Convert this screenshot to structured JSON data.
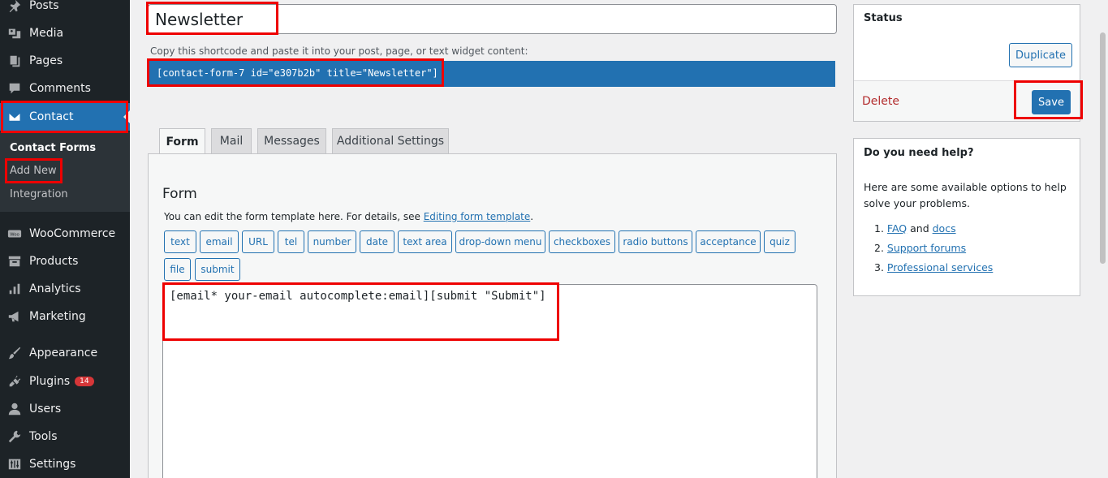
{
  "sidebar": {
    "items": [
      {
        "label": "Posts",
        "icon": "pin-icon"
      },
      {
        "label": "Media",
        "icon": "media-icon"
      },
      {
        "label": "Pages",
        "icon": "pages-icon"
      },
      {
        "label": "Comments",
        "icon": "comments-icon"
      },
      {
        "label": "Contact",
        "icon": "envelope-icon"
      },
      {
        "label": "WooCommerce",
        "icon": "woo-icon"
      },
      {
        "label": "Products",
        "icon": "archive-icon"
      },
      {
        "label": "Analytics",
        "icon": "bar-chart-icon"
      },
      {
        "label": "Marketing",
        "icon": "megaphone-icon"
      },
      {
        "label": "Appearance",
        "icon": "brush-icon"
      },
      {
        "label": "Plugins",
        "icon": "plug-icon",
        "badge": "14"
      },
      {
        "label": "Users",
        "icon": "user-icon"
      },
      {
        "label": "Tools",
        "icon": "wrench-icon"
      },
      {
        "label": "Settings",
        "icon": "settings-icon"
      }
    ],
    "submenu": [
      "Contact Forms",
      "Add New",
      "Integration"
    ]
  },
  "form_title": "Newsletter",
  "shortcode": {
    "hint": "Copy this shortcode and paste it into your post, page, or text widget content:",
    "code": "[contact-form-7 id=\"e307b2b\" title=\"Newsletter\"]"
  },
  "tabs": [
    "Form",
    "Mail",
    "Messages",
    "Additional Settings"
  ],
  "panel": {
    "title": "Form",
    "desc_prefix": "You can edit the form template here. For details, see ",
    "desc_link": "Editing form template",
    "desc_suffix": ".",
    "tag_buttons": [
      "text",
      "email",
      "URL",
      "tel",
      "number",
      "date",
      "text area",
      "drop-down menu",
      "checkboxes",
      "radio buttons",
      "acceptance",
      "quiz",
      "file",
      "submit"
    ],
    "template": "[email* your-email autocomplete:email][submit \"Submit\"]"
  },
  "status": {
    "title": "Status",
    "duplicate": "Duplicate",
    "delete": "Delete",
    "save": "Save"
  },
  "help": {
    "title": "Do you need help?",
    "desc": "Here are some available options to help solve your problems.",
    "item1_num": "1.",
    "item1_link1": "FAQ",
    "item1_and": " and ",
    "item1_link2": "docs",
    "item2_num": "2.",
    "item2_link": "Support forums",
    "item3_num": "3.",
    "item3_link": "Professional services"
  },
  "colors": {
    "accent": "#2271b1",
    "sidebar": "#1d2327",
    "annotation": "#e00000",
    "delete": "#b32d2e"
  }
}
